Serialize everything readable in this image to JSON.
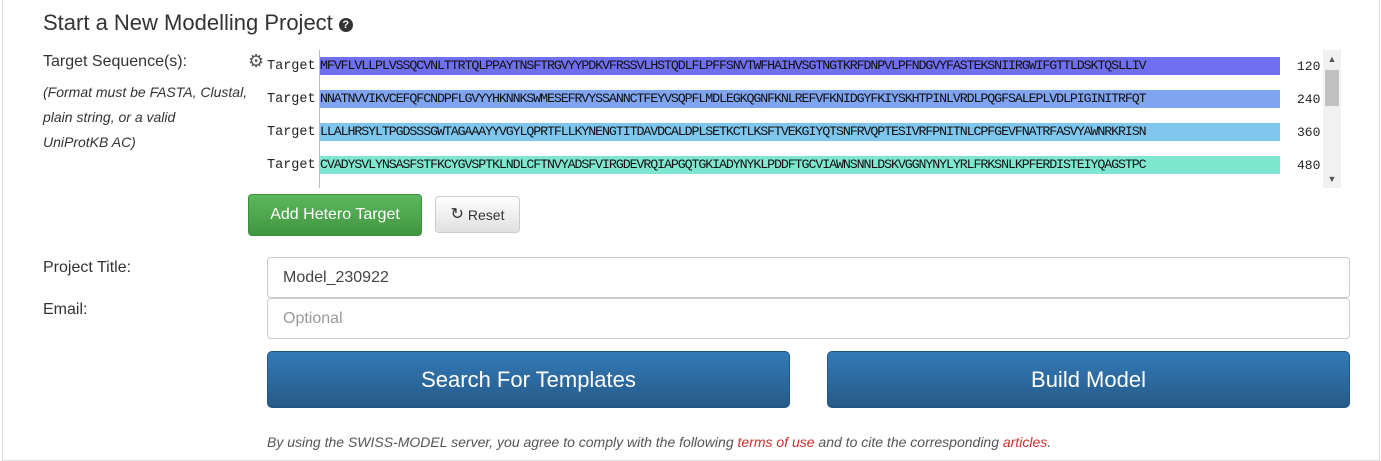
{
  "header": {
    "title": "Start a New Modelling Project",
    "help_icon": "question-circle-icon"
  },
  "target_section": {
    "label": "Target Sequence(s):",
    "hint_lines": [
      "(Format must be FASTA, Clustal,",
      "plain string, or a valid",
      "UniProtKB AC)"
    ],
    "settings_icon": "gear-icon",
    "rows": [
      {
        "label": "Target",
        "sequence": "MFVFLVLLPLVSSQCVNLTTRTQLPPAYTNSFTRGVYYPDKVFRSSVLHSTQDLFLPFFSNVTWFHAIHVSGTNGTKRFDNPVLPFNDGVYFASTEKSNIIRGWIFGTTLDSKTQSLLIV",
        "end": "120",
        "color": "#6f6ff0"
      },
      {
        "label": "Target",
        "sequence": "NNATNVVIKVCEFQFCNDPFLGVYYHKNNKSWMESEFRVYSSANNCTFEYVSQPFLMDLEGKQGNFKNLREFVFKNIDGYFKIYSKHTPINLVRDLPQGFSALEPLVDLPIGINITRFQT",
        "end": "240",
        "color": "#7fa4f0"
      },
      {
        "label": "Target",
        "sequence": "LLALHRSYLTPGDSSSGWTAGAAAYYVGYLQPRTFLLKYNENGTITDAVDCALDPLSETKCTLKSFTVEKGIYQTSNFRVQPTESIVRFPNITNLCPFGEVFNATRFASVYAWNRKRISN",
        "end": "360",
        "color": "#7ec6ee"
      },
      {
        "label": "Target",
        "sequence": "CVADYSVLYNSASFSTFKCYGVSPTKLNDLCFTNVYADSFVIRGDEVRQIAPGQTGKIADYNYKLPDDFTGCVIAWNSNNLDSKVGGNYNYLYRLFRKSNLKPFERDISTEIYQAGSTPC",
        "end": "480",
        "color": "#7fe7d0"
      }
    ]
  },
  "buttons": {
    "add_hetero": "Add Hetero Target",
    "reset": "Reset",
    "reset_icon": "refresh-icon",
    "search_templates": "Search For Templates",
    "build_model": "Build Model"
  },
  "form": {
    "project_title_label": "Project Title:",
    "project_title_value": "Model_230922",
    "email_label": "Email:",
    "email_placeholder": "Optional"
  },
  "footer": {
    "text_before": "By using the SWISS-MODEL server, you agree to comply with the following ",
    "link_terms": "terms of use",
    "text_middle": " and to cite the corresponding ",
    "link_articles": "articles",
    "text_after": "."
  },
  "colors": {
    "green": "#4cae4c",
    "blue": "#2e6da4",
    "link": "#c9302c"
  }
}
